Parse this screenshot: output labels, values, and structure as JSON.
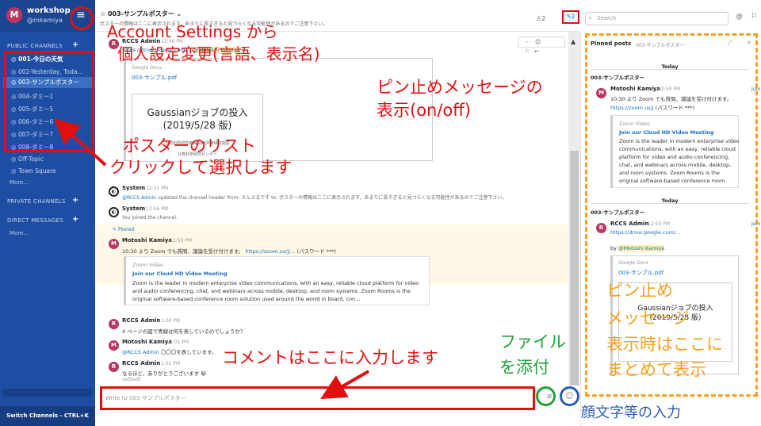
{
  "sidebar": {
    "team_initial": "M",
    "team_name": "workshop",
    "team_user": "@mkamiya",
    "public_header": "PUBLIC CHANNELS",
    "public_channels": [
      "001-今日の天気",
      "002-Yesterday, Toda...",
      "003-サンプルポスター",
      "004-ダミー1",
      "005-ダミー5",
      "006-ダミー6",
      "007-ダミー7",
      "008-ダミー8",
      "Off-Topic",
      "Town Square"
    ],
    "more1": "More...",
    "private_header": "PRIVATE CHANNELS",
    "dm_header": "DIRECT MESSAGES",
    "more2": "More...",
    "switch_label": "Switch Channels - CTRL+K"
  },
  "header": {
    "channel_title": "☆ 003-サンプルポスター ⌄",
    "channel_desc": "ポスターの情報はここに表示されます。あまりに長すぎると見づらくなる可能性があるのでご注意下さい。",
    "members": "2",
    "pinned_count": "2",
    "search_placeholder": "Search"
  },
  "posts": {
    "p1": {
      "user": "RCCS Admin",
      "time": "12:50 PM",
      "link": "https://drive.google.com/...",
      "mention": "@Motoshi Kamiya",
      "gdoc_label": "Google Docs",
      "gdoc_name": "003-サンプル.pdf",
      "doc_title": "Gaussianジョブの投入",
      "doc_date": "(2019/5/28 版)",
      "doc_org": "自然科学研究機構 岡崎共通研究施設",
      "doc_dept": "計算科学研究センター"
    },
    "p2": {
      "user": "System",
      "time": "12:51 PM",
      "text_mention": "@RCCS Admin",
      "text": "updated the channel header from: さんぷるです to: ポスターの情報はここに表示されます。あまりに長すぎると見づらくなる可能性があるのでご注意下さい。"
    },
    "p3": {
      "user": "System",
      "time": "12:56 PM",
      "text": "You joined the channel."
    },
    "p4": {
      "pinned": "Pinned",
      "user": "Motoshi Kamiya",
      "time": "12:59 PM",
      "text": "10:30 より Zoom でも質問、議論を受け付けます。",
      "link": "https://zoom.us/j/...",
      "pw": "(パスワード ***)",
      "card_site": "Zoom Video",
      "card_title": "Join our Cloud HD Video Meeting",
      "card_body": "Zoom is the leader in modern enterprise video communications, with an easy, reliable cloud platform for video and audio conferencing, chat, and webinars across mobile, desktop, and room systems. Zoom Rooms is the original software-based conference room solution used around the world in board, con..."
    },
    "p5": {
      "user": "RCCS Admin",
      "time": "1:00 PM",
      "text": "4 ページの図で青線は何を表しているのでしょうか？"
    },
    "p6": {
      "user": "Motoshi Kamiya",
      "time": "1:01 PM",
      "mention": "@RCCS Admin",
      "text": "〇〇〇を表しています。"
    },
    "p7": {
      "user": "RCCS Admin",
      "time": "1:01 PM",
      "text": "なるほど、ありがとうございます 😀",
      "edited": "(edited)"
    }
  },
  "input": {
    "placeholder": "Write to 003-サンプルポスター"
  },
  "rhs": {
    "title": "Pinned posts",
    "subtitle": "003-サンプルポスター",
    "day1": "Today",
    "ch1": "003-サンプルポスター",
    "r1_user": "Motoshi Kamiya",
    "r1_time": "12:59 PM",
    "r1_jump": "Jum",
    "r1_text": "10:30 より Zoom でも質問、議論を受け付けます。",
    "r1_link": "https://zoom.us/j",
    "r1_pw": "(パスワード ***)",
    "r1_card_site": "Zoom Video",
    "r1_card_title": "Join our Cloud HD Video Meeting",
    "r1_card_body": "Zoom is the leader in modern enterprise video communications, with an easy, reliable cloud platform for video and audio conferencing, chat, and webinars across mobile, desktop, and room systems. Zoom Rooms is the original software-based conference room solution used around the world in board, con...",
    "day2": "Today",
    "ch2": "003-サンプルポスター",
    "r2_user": "RCCS Admin",
    "r2_time": "12:50 PM",
    "r2_jump": "Jum",
    "r2_link": "https://drive.google.com/...",
    "r2_by": "by",
    "r2_mention": "@Motoshi Kamiya",
    "r2_gdoc_label": "Google Docs",
    "r2_gdoc_name": "003-サンプル.pdf",
    "r2_doc_title": "Gaussianジョブの投入",
    "r2_doc_date": "(2019/5/28 版)"
  },
  "annotations": {
    "account1": "Account Settings から",
    "account2": "個人設定変更(言語、表示名)",
    "pin1": "ピン止めメッセージの",
    "pin2": "表示(on/off)",
    "poster1": "ポスターのリスト",
    "poster2": "クリックして選択します",
    "comment": "コメントはここに入力します",
    "file1": "ファイル",
    "file2": "を添付",
    "emoji": "顔文字等の入力",
    "rhs1": "ピン止め",
    "rhs2": "メッセージ",
    "rhs3": "表示時はここに",
    "rhs4": "まとめて表示"
  }
}
